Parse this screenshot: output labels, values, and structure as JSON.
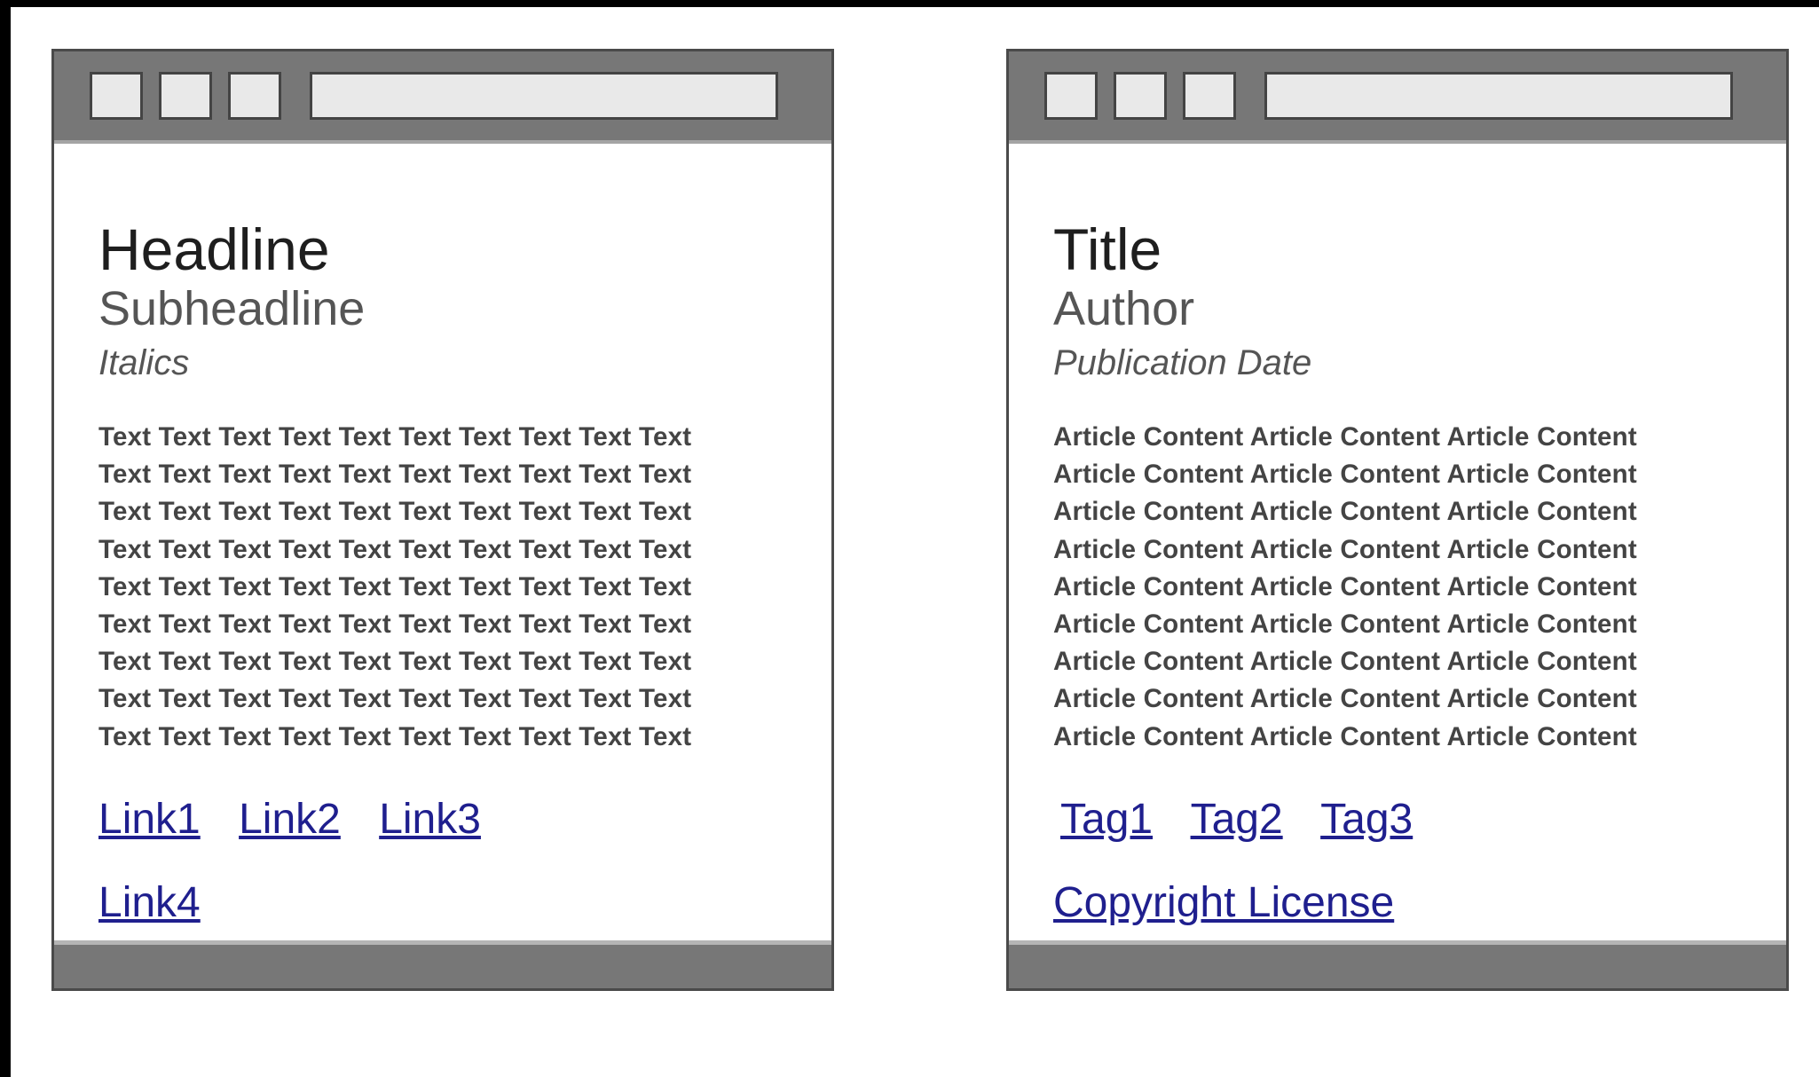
{
  "colors": {
    "background": "#000000",
    "page": "#ffffff",
    "chrome": "#777777",
    "chrome_button": "#e9e9e9",
    "link": "#1f1f8e"
  },
  "left_window": {
    "headline": "Headline",
    "subheadline": "Subheadline",
    "italic": "Italics",
    "body_lines": [
      "Text Text Text Text Text Text Text Text Text Text",
      "Text Text Text Text Text Text Text Text Text Text",
      "Text Text Text Text Text Text Text Text Text Text",
      "Text Text Text Text Text Text Text Text Text Text",
      "Text Text Text Text Text Text Text Text Text Text",
      "Text Text Text Text Text Text Text Text Text Text",
      "Text Text Text Text Text Text Text Text Text Text",
      "Text Text Text Text Text Text Text Text Text Text",
      "Text Text Text Text Text Text Text Text Text Text"
    ],
    "links": [
      "Link1",
      "Link2",
      "Link3"
    ],
    "link4": "Link4"
  },
  "right_window": {
    "title": "Title",
    "author": "Author",
    "publication_date": "Publication Date",
    "body_lines": [
      "Article Content Article Content Article Content",
      "Article Content Article Content Article Content",
      "Article Content Article Content Article Content",
      "Article Content Article Content Article Content",
      "Article Content Article Content Article Content",
      "Article Content Article Content Article Content",
      "Article Content Article Content Article Content",
      "Article Content Article Content Article Content",
      "Article Content Article Content Article Content"
    ],
    "tags": [
      "Tag1",
      "Tag2",
      "Tag3"
    ],
    "license": "Copyright License"
  }
}
